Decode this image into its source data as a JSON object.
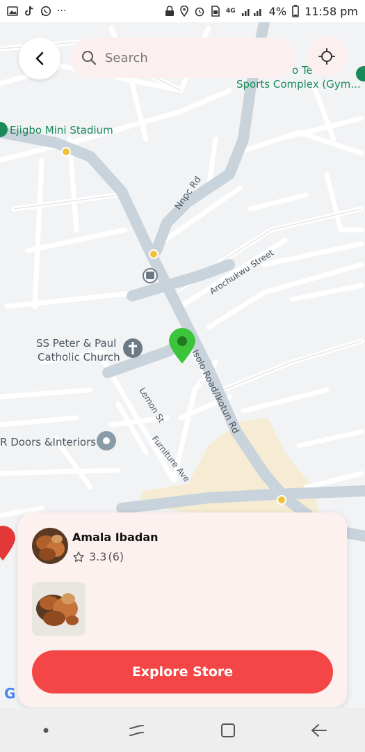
{
  "status_bar": {
    "left_icons": [
      "image-icon",
      "tiktok-icon",
      "whatsapp-icon",
      "more-icon"
    ],
    "more": "···",
    "network_4g": "4G",
    "battery": "4%",
    "time": "11:58 pm"
  },
  "map": {
    "labels": {
      "stadium": "Ejigbo Mini Stadium",
      "sports_top": "o Te     lub",
      "sports_bottom": "Sports Complex (Gym...",
      "nnpc": "Nnpc Rd",
      "arochukwu": "Arochukwu Street",
      "church_line1": "SS Peter & Paul",
      "church_line2": "Catholic Church",
      "isolo": "Isolo Road/Ikotun Rd",
      "lemon": "Lemon St",
      "furniture": "Furniture Ave",
      "doors": "R Doors &Interiors",
      "google_g": "G"
    },
    "colors": {
      "land": "#f2f3f5",
      "road_major": "#c9d3db",
      "road_minor": "#ffffff",
      "poi_green": "#1a8a5a",
      "pin_green": "#3cc43a",
      "pin_red": "#e33838",
      "landuse": "#f6ecd3"
    }
  },
  "search": {
    "placeholder": "Search"
  },
  "card": {
    "store_name": "Amala Ibadan",
    "rating": "3.3",
    "reviews": "(6)",
    "button_label": "Explore Store"
  },
  "nav": {
    "icons": [
      "dot-icon",
      "recents-icon",
      "home-icon",
      "back-arrow-icon"
    ]
  }
}
